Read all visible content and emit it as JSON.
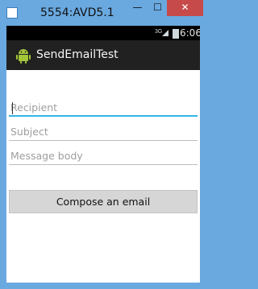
{
  "window": {
    "title": "5554:AVD5.1",
    "minimize_glyph": "—",
    "maximize_glyph": "☐",
    "close_glyph": "✕"
  },
  "status_bar": {
    "network": "3G",
    "time": "6:06"
  },
  "action_bar": {
    "app_title": "SendEmailTest",
    "icon": "android-icon"
  },
  "form": {
    "recipient_placeholder": "Recipient",
    "subject_placeholder": "Subject",
    "body_placeholder": "Message body",
    "compose_label": "Compose an email"
  },
  "colors": {
    "frame": "#6aa9e0",
    "action_bar": "#212121",
    "accent": "#33b5e5",
    "button": "#d6d6d6",
    "close_button": "#c74a4a"
  }
}
